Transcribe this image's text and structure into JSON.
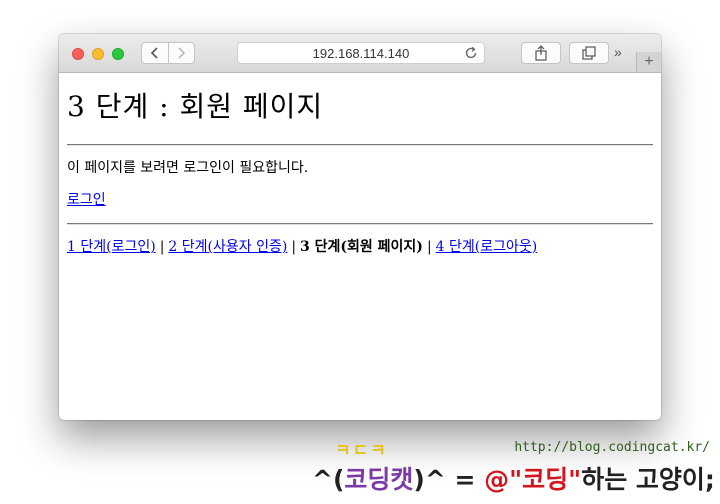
{
  "browser": {
    "address": "192.168.114.140",
    "more_label": "»",
    "new_tab_label": "+"
  },
  "page": {
    "title": "3 단계 : 회원 페이지",
    "message": "이 페이지를 보려면 로그인이 필요합니다.",
    "login_link": "로그인",
    "nav": {
      "step1": "1 단계(로그인)",
      "step2": "2 단계(사용자 인증)",
      "step3": "3 단계(회원 페이지)",
      "step4": "4 단계(로그아웃)",
      "separator": "|"
    }
  },
  "watermark": {
    "url": "http://blog.codingcat.kr/",
    "top_text": "ㅋㄷㅋ",
    "part1": "^(",
    "part2": "코딩캣",
    "part3": ")^ = ",
    "part4": "@\"코딩\"",
    "part5": "하는 고양이;"
  }
}
